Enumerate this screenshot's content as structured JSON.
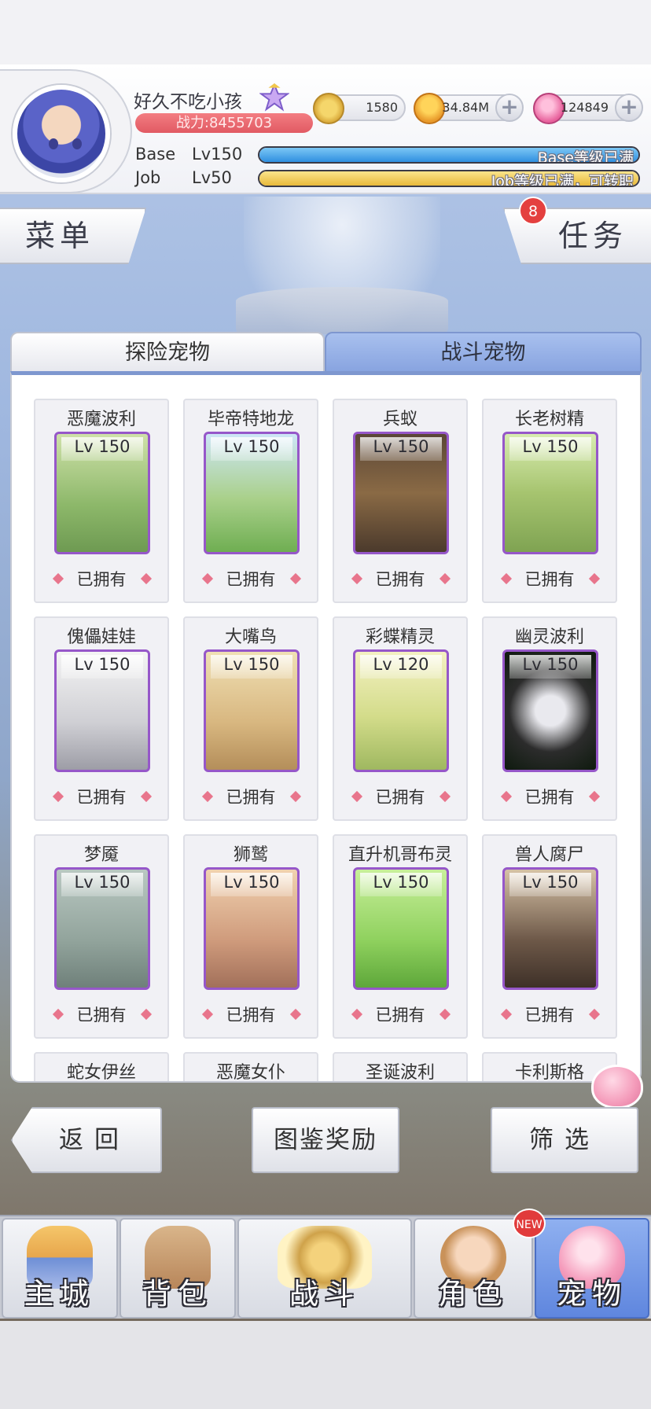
{
  "player": {
    "name": "好久不吃小孩",
    "power": "战力:8455703",
    "currencies": [
      {
        "icon": "zeny-coin-icon",
        "value": "1580",
        "plus": false
      },
      {
        "icon": "gold-coin-icon",
        "value": "34.84M",
        "plus": true
      },
      {
        "icon": "pink-gem-icon",
        "value": "124849",
        "plus": true
      }
    ],
    "base": {
      "label": "Base",
      "level": "Lv150",
      "status": "Base等级已满",
      "progress": 1.0
    },
    "job": {
      "label": "Job",
      "level": "Lv50",
      "status": "Job等级已满，可转职",
      "progress": 1.0
    }
  },
  "side": {
    "menu": "菜单",
    "tasks": "任务",
    "task_badge": "8"
  },
  "tabs": [
    {
      "label": "探险宠物",
      "active": false
    },
    {
      "label": "战斗宠物",
      "active": true
    }
  ],
  "owned_label": "已拥有",
  "pets": [
    {
      "name": "恶魔波利",
      "level": "Lv 150",
      "owned": true
    },
    {
      "name": "毕帝特地龙",
      "level": "Lv 150",
      "owned": true
    },
    {
      "name": "兵蚁",
      "level": "Lv 150",
      "owned": true
    },
    {
      "name": "长老树精",
      "level": "Lv 150",
      "owned": true
    },
    {
      "name": "傀儡娃娃",
      "level": "Lv 150",
      "owned": true
    },
    {
      "name": "大嘴鸟",
      "level": "Lv 150",
      "owned": true
    },
    {
      "name": "彩蝶精灵",
      "level": "Lv 120",
      "owned": true
    },
    {
      "name": "幽灵波利",
      "level": "Lv 150",
      "owned": true
    },
    {
      "name": "梦魇",
      "level": "Lv 150",
      "owned": true
    },
    {
      "name": "狮鹫",
      "level": "Lv 150",
      "owned": true
    },
    {
      "name": "直升机哥布灵",
      "level": "Lv 150",
      "owned": true
    },
    {
      "name": "兽人腐尸",
      "level": "Lv 150",
      "owned": true
    },
    {
      "name": "蛇女伊丝",
      "level": "",
      "owned": false
    },
    {
      "name": "恶魔女仆",
      "level": "",
      "owned": false
    },
    {
      "name": "圣诞波利",
      "level": "",
      "owned": false
    },
    {
      "name": "卡利斯格",
      "level": "",
      "owned": false
    }
  ],
  "footer": {
    "back": "返回",
    "rewards": "图鉴奖励",
    "filter": "筛选"
  },
  "nav": [
    {
      "label": "主城",
      "icon": "castle-icon",
      "active": false
    },
    {
      "label": "背包",
      "icon": "backpack-icon",
      "active": false
    },
    {
      "label": "战斗",
      "icon": "crossed-swords-icon",
      "active": false
    },
    {
      "label": "角色",
      "icon": "character-icon",
      "active": false
    },
    {
      "label": "宠物",
      "icon": "poring-pet-icon",
      "active": true
    }
  ],
  "nav_new_badge": "NEW",
  "colors": {
    "accent": "#88a4e0",
    "portrait_border": "#9657c9",
    "power": "#e15a63",
    "base_bar": "#3f9ee6",
    "job_bar": "#f0c84a"
  }
}
